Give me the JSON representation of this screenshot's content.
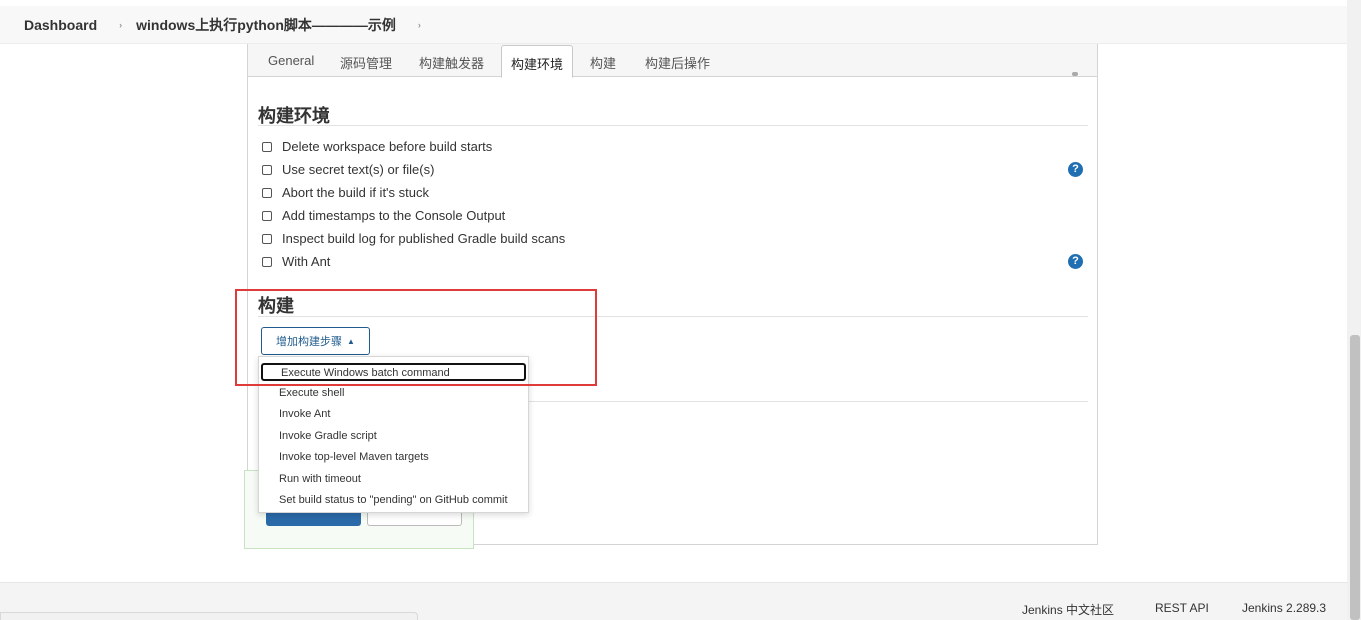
{
  "breadcrumb": {
    "home": "Dashboard",
    "job": "windows上执行python脚本————示例",
    "separator": "›"
  },
  "tabs": [
    {
      "label": "General",
      "active": false
    },
    {
      "label": "源码管理",
      "active": false
    },
    {
      "label": "构建触发器",
      "active": false
    },
    {
      "label": "构建环境",
      "active": true
    },
    {
      "label": "构建",
      "active": false
    },
    {
      "label": "构建后操作",
      "active": false
    }
  ],
  "build_env": {
    "title": "构建环境",
    "options": [
      {
        "label": "Delete workspace before build starts",
        "checked": false
      },
      {
        "label": "Use secret text(s) or file(s)",
        "checked": false
      },
      {
        "label": "Abort the build if it's stuck",
        "checked": false
      },
      {
        "label": "Add timestamps to the Console Output",
        "checked": false
      },
      {
        "label": "Inspect build log for published Gradle build scans",
        "checked": false
      },
      {
        "label": "With Ant",
        "checked": false
      }
    ],
    "help_glyph": "?"
  },
  "build": {
    "title": "构建",
    "add_step_label": "增加构建步骤",
    "caret": "▲",
    "menu_items": [
      "Execute Windows batch command",
      "Execute shell",
      "Invoke Ant",
      "Invoke Gradle script",
      "Invoke top-level Maven targets",
      "Run with timeout",
      "Set build status to \"pending\" on GitHub commit"
    ]
  },
  "footer": {
    "community": "Jenkins 中文社区",
    "rest_api": "REST API",
    "version": "Jenkins 2.289.3"
  },
  "colors": {
    "accent": "#1f6fb2",
    "highlight_box": "#e03b3b"
  }
}
